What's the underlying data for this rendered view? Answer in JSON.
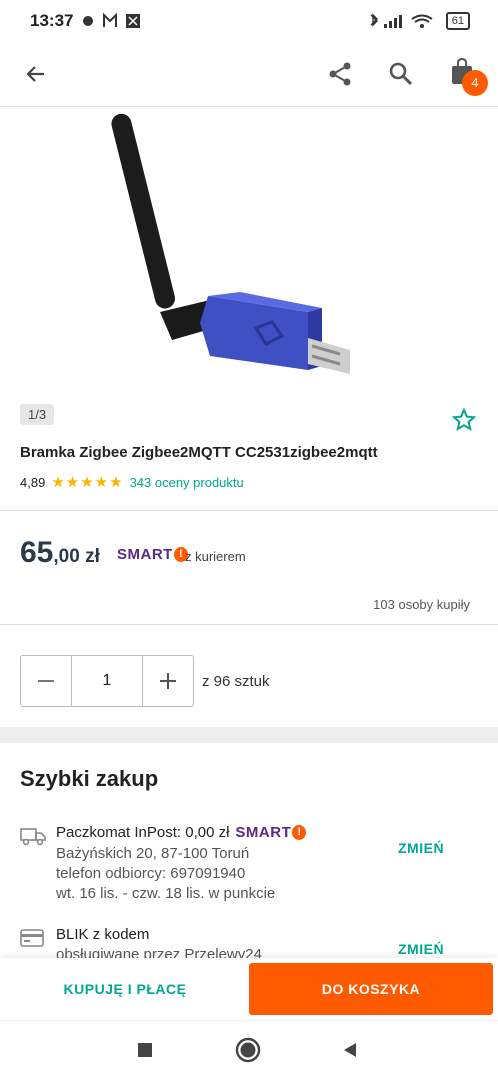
{
  "status_bar": {
    "time": "13:37",
    "battery": "61"
  },
  "header": {
    "cart_count": "4"
  },
  "gallery": {
    "pager": "1/3"
  },
  "product": {
    "title": "Bramka Zigbee Zigbee2MQTT CC2531zigbee2mqtt",
    "rating_value": "4,89",
    "rating_stars": 4.89,
    "reviews_link": "343 oceny produktu"
  },
  "pricing": {
    "price_main": "65",
    "price_fraction": ",00 zł",
    "smart_label": "SMART",
    "smart_mark": "!",
    "delivery_note": "z kurierem",
    "bought_count": "103 osoby kupiły"
  },
  "quantity": {
    "value": "1",
    "stock": "z 96 sztuk"
  },
  "quick_buy": {
    "title": "Szybki zakup",
    "shipping": {
      "method": "Paczkomat InPost: 0,00 zł",
      "smart_label": "SMART",
      "address": "Bażyńskich 20, 87-100 Toruń",
      "phone": "telefon odbiorcy: 697091940",
      "delivery_time": "wt. 16 lis. - czw. 18 lis. w punkcie",
      "change_label": "ZMIEŃ"
    },
    "payment": {
      "method": "BLIK z kodem",
      "provider": "obsługiwane przez Przelewy24",
      "change_label": "ZMIEŃ"
    }
  },
  "actions": {
    "buy_now": "KUPUJĘ I PŁACĘ",
    "add_to_cart": "DO KOSZYKA"
  },
  "colors": {
    "accent": "#00a790",
    "brand_orange": "#ff5a00",
    "smart_purple": "#5b2a86",
    "star": "#f5b700"
  },
  "icons": [
    "back-arrow-icon",
    "share-icon",
    "search-icon",
    "cart-icon",
    "star-outline-icon",
    "truck-icon",
    "card-icon"
  ]
}
